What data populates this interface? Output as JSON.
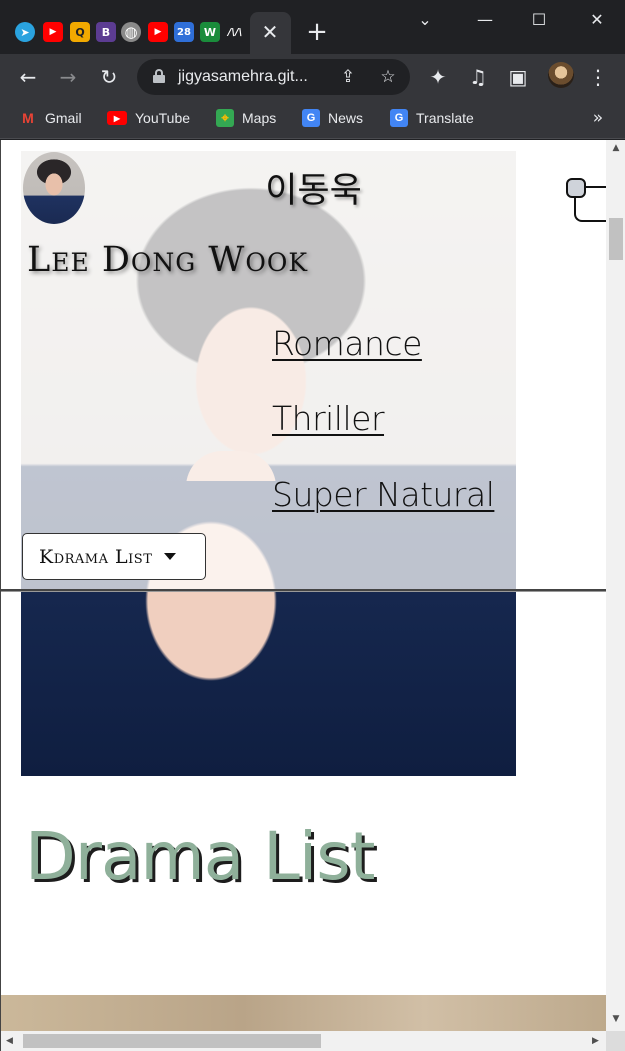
{
  "browser": {
    "tabs": {
      "favicons": [
        {
          "name": "telegram-icon",
          "glyph": "➤",
          "color": "#2aa3df"
        },
        {
          "name": "youtube-icon",
          "glyph": "▶",
          "color": "#ff0000"
        },
        {
          "name": "q-icon",
          "glyph": "Q",
          "color": "#f2a900"
        },
        {
          "name": "b-icon",
          "glyph": "B",
          "color": "#5c3c92"
        },
        {
          "name": "globe-icon",
          "glyph": "◍",
          "color": "#8a8a8a"
        },
        {
          "name": "youtube-icon-2",
          "glyph": "▶",
          "color": "#ff0000"
        },
        {
          "name": "colorful-icon",
          "glyph": "28",
          "color": "#2f6fd8"
        },
        {
          "name": "w-icon",
          "glyph": "W",
          "color": "#1a8c3b"
        },
        {
          "name": "medium-icon",
          "glyph": "/\\/\\",
          "color": "#202124"
        }
      ],
      "close_glyph": "✕",
      "new_tab_glyph": "+"
    },
    "window_controls": {
      "dropdown": "⌄",
      "minimize": "—",
      "maximize": "☐",
      "close": "✕"
    },
    "toolbar": {
      "back": "←",
      "forward": "→",
      "reload": "↻",
      "url": "jigyasamehra.git...",
      "share": "⇪",
      "bookmark_star": "☆",
      "extensions": "✦",
      "media": "♫",
      "sidepanel": "▣",
      "menu": "⋮"
    },
    "bookmarks": [
      {
        "name": "gmail",
        "label": "Gmail",
        "glyph": "M",
        "color": "#ea4335"
      },
      {
        "name": "youtube",
        "label": "YouTube",
        "glyph": "▶",
        "color": "#ff0000"
      },
      {
        "name": "maps",
        "label": "Maps",
        "glyph": "⌖",
        "color": "#34a853"
      },
      {
        "name": "news",
        "label": "News",
        "glyph": "G",
        "color": "#4285f4"
      },
      {
        "name": "translate",
        "label": "Translate",
        "glyph": "G",
        "color": "#4285f4"
      }
    ],
    "bookmarks_more": "»"
  },
  "page": {
    "korean_name": "이동욱",
    "english_name": "Lee Dong Wook",
    "nav_links": [
      "Romance",
      "Thriller",
      "Super Natural"
    ],
    "dropdown_label": "Kdrama List",
    "section_title": "Drama List"
  },
  "scrollbars": {
    "up": "▲",
    "down": "▼",
    "left": "◀",
    "right": "▶"
  }
}
